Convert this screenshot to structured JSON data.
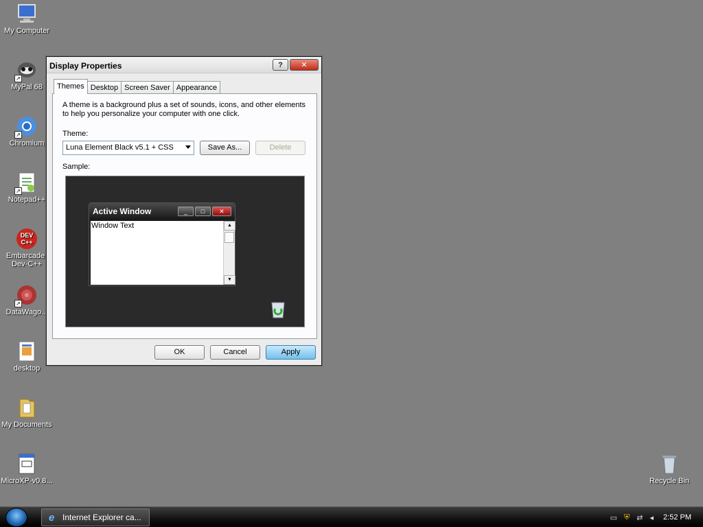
{
  "desktop_icons": [
    {
      "label": "My Computer",
      "icon": "computer-icon"
    },
    {
      "label": "MyPal 68",
      "icon": "mypal-icon"
    },
    {
      "label": "Chromium",
      "icon": "chromium-icon"
    },
    {
      "label": "Notepad++",
      "icon": "notepad-plus-icon"
    },
    {
      "label": "Embarcader Dev-C++",
      "icon": "devcpp-icon"
    },
    {
      "label": "DataWago...",
      "icon": "datawagon-icon"
    },
    {
      "label": "desktop",
      "icon": "image-file-icon"
    },
    {
      "label": "My Documents",
      "icon": "folder-icon"
    },
    {
      "label": "MicroXP-v0.8...",
      "icon": "text-file-icon"
    },
    {
      "label": "Recycle Bin",
      "icon": "recycle-bin-icon"
    }
  ],
  "dialog": {
    "title": "Display Properties",
    "help_label": "?",
    "close_label": "✕",
    "tabs": [
      "Themes",
      "Desktop",
      "Screen Saver",
      "Appearance"
    ],
    "active_tab": "Themes",
    "description": "A theme is a background plus a set of sounds, icons, and other elements to help you personalize your computer with one click.",
    "theme_label": "Theme:",
    "theme_value": "Luna Element Black v5.1 + CSS",
    "save_as_label": "Save As...",
    "delete_label": "Delete",
    "sample_label": "Sample:",
    "sample_window_title": "Active Window",
    "sample_window_text": "Window Text",
    "ok_label": "OK",
    "cancel_label": "Cancel",
    "apply_label": "Apply"
  },
  "taskbar": {
    "task_label": "Internet Explorer ca...",
    "clock": "2:52 PM"
  }
}
